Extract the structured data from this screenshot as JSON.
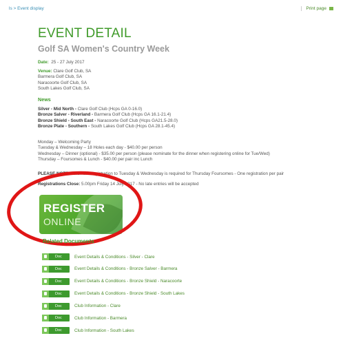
{
  "breadcrumb": "ls > Event display",
  "print": {
    "label": "Print page"
  },
  "event": {
    "heading": "EVENT DETAIL",
    "name": "Golf SA Women's Country Week",
    "date_label": "Date:",
    "date_value": "25 - 27 July 2017",
    "venue_label": "Venue:",
    "venues": [
      "Clare Golf Club, SA",
      "Barmera Golf Club, SA",
      "Naracoorte Golf Club, SA",
      "South Lakes Golf Club, SA"
    ]
  },
  "news": {
    "heading": "News",
    "items": [
      {
        "bold": "Silver - Mid North -",
        "text": " Clare Golf Club (Hcps GA 0-16.0)"
      },
      {
        "bold": "Bronze Salver - Riverland -",
        "text": " Barmera Golf Club (Hcps GA 16.1-21.4)"
      },
      {
        "bold": "Bronze Shield - South East -",
        "text": " Naracoorte Golf Club (Hcps GA21.5-28.0)"
      },
      {
        "bold": "Bronze Plate - Southern -",
        "text": " South Lakes Golf Club (Hcps GA 28.1-45.4)"
      }
    ],
    "schedule": [
      "Monday – Welcoming Party",
      "Tuesday & Wednesday – 18 Holes each day - $40.00 per person",
      "Wednesday – Dinner (optional) - $35.00 per person (please nominate for the dinner when registering online for Tue/Wed)",
      "Thursday – Foursomes & Lunch - $40.00 per pair inc Lunch"
    ],
    "note_bold": "PLEASE NOTE:",
    "note_text": " Automatic registration to Tuesday & Wednesday is required for Thursday Foursomes - One registration per pair",
    "close_bold": "Registrations Close:",
    "close_text": " 5.00pm Friday 14 July 2017 - No late entries will be accepted"
  },
  "register": {
    "line1": "REGISTER",
    "line2": "ONLINE"
  },
  "related": {
    "heading": "Related Documents",
    "badge": "Doc",
    "docs": [
      "Event Details & Conditions - Silver - Clare",
      "Event Details & Conditions - Bronze Salver - Barmera",
      "Event Details & Conditions - Bronze Shield - Naracoorte",
      "Event Details & Conditions - Bronze Shield - South Lakes",
      "Club Information - Clare",
      "Club Information - Barmera",
      "Club Information - South Lakes"
    ]
  },
  "colors": {
    "brand_green": "#3f9a29",
    "highlight_red": "#e01616"
  }
}
